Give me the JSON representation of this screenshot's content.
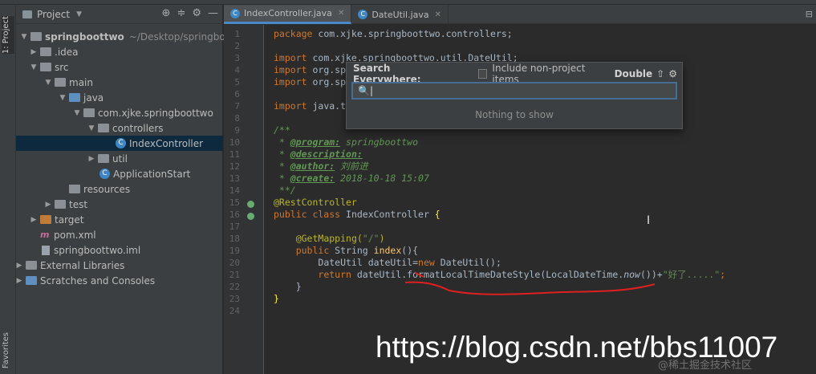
{
  "rail": {
    "project_tab": "1: Project",
    "favorites_tab": "Favorites"
  },
  "project_panel": {
    "title": "Project",
    "tree": [
      {
        "label": "springboottwo",
        "extra": "~/Desktop/springbo",
        "bold": true
      },
      {
        "label": ".idea"
      },
      {
        "label": "src"
      },
      {
        "label": "main"
      },
      {
        "label": "java"
      },
      {
        "label": "com.xjke.springboottwo"
      },
      {
        "label": "controllers"
      },
      {
        "label": "IndexController"
      },
      {
        "label": "util"
      },
      {
        "label": "ApplicationStart"
      },
      {
        "label": "resources"
      },
      {
        "label": "test"
      },
      {
        "label": "target"
      },
      {
        "label": "pom.xml"
      },
      {
        "label": "springboottwo.iml"
      },
      {
        "label": "External Libraries"
      },
      {
        "label": "Scratches and Consoles"
      }
    ]
  },
  "tabs": [
    {
      "label": "IndexController.java",
      "active": true
    },
    {
      "label": "DateUtil.java",
      "active": false
    }
  ],
  "line_numbers": [
    "1",
    "2",
    "3",
    "4",
    "5",
    "6",
    "7",
    "8",
    "9",
    "10",
    "11",
    "12",
    "13",
    "14",
    "15",
    "16",
    "17",
    "18",
    "19",
    "20",
    "21",
    "22",
    "23",
    "24"
  ],
  "code": {
    "l1_kw": "package ",
    "l1": "com.xjke.springboottwo.controllers;",
    "l3_kw": "import ",
    "l3": "com.xjke.springboottwo.util.DateUtil;",
    "l4_kw": "import ",
    "l4": "org.sp",
    "l5_kw": "import ",
    "l5": "org.sp",
    "l7_kw": "import ",
    "l7": "java.t",
    "l9": "/**",
    "l10_star": " * ",
    "l10_tag": "@program:",
    "l10_val": " springboottwo",
    "l11_star": " * ",
    "l11_tag": "@description:",
    "l12_star": " * ",
    "l12_tag": "@author:",
    "l12_val": " 刘前进",
    "l13_star": " * ",
    "l13_tag": "@create:",
    "l13_val": " 2018-10-18 15:07",
    "l14": " **/",
    "l15": "@RestController",
    "l16_kw": "public class ",
    "l16": "IndexController ",
    "l16_brace": "{",
    "l18_ann": "@GetMapping(",
    "l18_str": "\"/\"",
    "l18_end": ")",
    "l19_kw": "public ",
    "l19_type": "String ",
    "l19_fn": "index",
    "l19_end": "(){",
    "l20_a": "DateUtil dateUtil=",
    "l20_kw": "new ",
    "l20_b": "DateUtil();",
    "l21_kw": "return ",
    "l21_a": "dateUtil.formatLocalTimeDateStyle(LocalDateTime.",
    "l21_it": "now",
    "l21_b": "())+",
    "l21_str": "\"好了.....\"",
    "l21_end": ";",
    "l22": "}",
    "l23": "}"
  },
  "search_popup": {
    "title": "Search Everywhere:",
    "option_label": "Include non-project items",
    "shortcut": "Double",
    "input_value": "",
    "empty_text": "Nothing to show"
  },
  "watermark": "https://blog.csdn.net/bbs11007",
  "watermark_small": "@稀土掘金技术社区",
  "colors": {
    "selection": "#0d293e",
    "keyword": "#cc7832",
    "comment": "#629755",
    "annotation": "#bbb529",
    "string": "#6a8759",
    "accent": "#4a88c7",
    "underline": "#e02020"
  }
}
